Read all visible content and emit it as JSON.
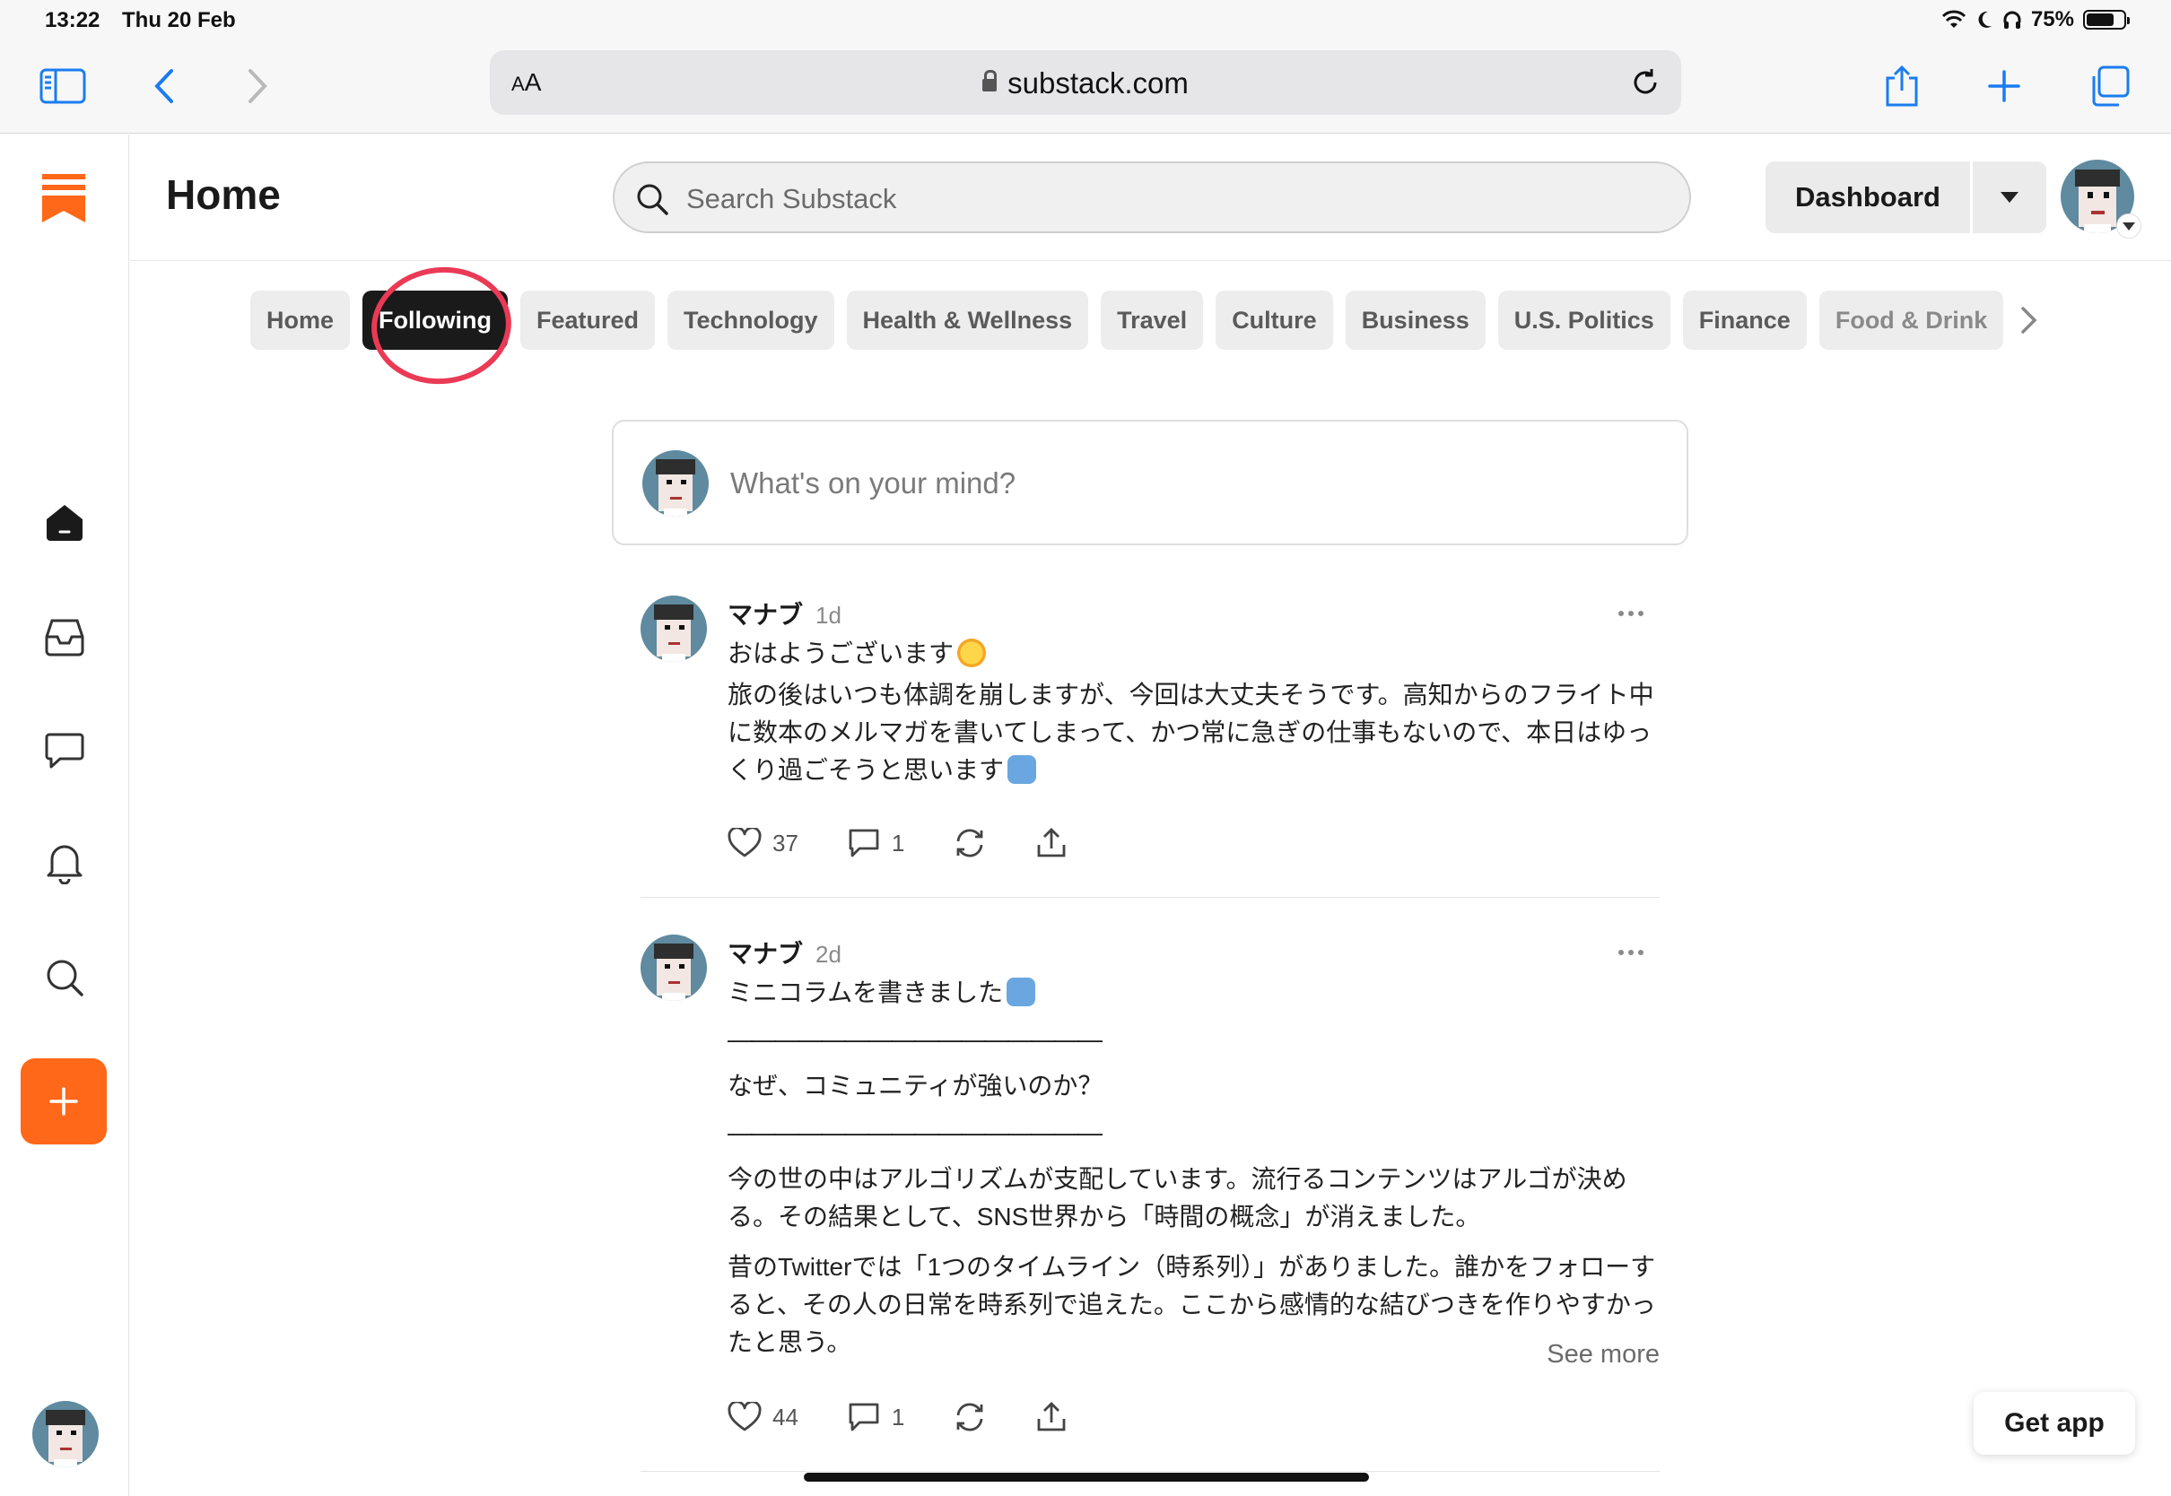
{
  "status_bar": {
    "time": "13:22",
    "date": "Thu 20 Feb",
    "battery": "75%",
    "battery_level": 0.75
  },
  "browser": {
    "text_size_label_small": "A",
    "text_size_label_large": "A",
    "url": "substack.com"
  },
  "header": {
    "title": "Home",
    "search_placeholder": "Search Substack",
    "dashboard_label": "Dashboard"
  },
  "tabs": [
    {
      "label": "Home",
      "active": false
    },
    {
      "label": "Following",
      "active": true
    },
    {
      "label": "Featured",
      "active": false
    },
    {
      "label": "Technology",
      "active": false
    },
    {
      "label": "Health & Wellness",
      "active": false
    },
    {
      "label": "Travel",
      "active": false
    },
    {
      "label": "Culture",
      "active": false
    },
    {
      "label": "Business",
      "active": false
    },
    {
      "label": "U.S. Politics",
      "active": false
    },
    {
      "label": "Finance",
      "active": false
    },
    {
      "label": "Food & Drink",
      "active": false
    }
  ],
  "composer": {
    "placeholder": "What's on your mind?"
  },
  "posts": [
    {
      "author": "マナブ",
      "ago": "1d",
      "paragraphs": [
        "おはようございます",
        "旅の後はいつも体調を崩しますが、今回は大丈夫そうです。高知からのフライト中に数本のメルマガを書いてしまって、かつ常に急ぎの仕事もないので、本日はゆっくり過ごそうと思います"
      ],
      "likes": "37",
      "comments": "1"
    },
    {
      "author": "マナブ",
      "ago": "2d",
      "paragraphs": [
        "ミニコラムを書きました",
        "————————————————",
        "なぜ、コミュニティが強いのか？",
        "————————————————",
        "今の世の中はアルゴリズムが支配しています。流行るコンテンツはアルゴが決める。その結果として、SNS世界から「時間の概念」が消えました。",
        "昔のTwitterでは「1つのタイムライン（時系列）」がありました。誰かをフォローすると、その人の日常を時系列で追えた。ここから感情的な結びつきを作りやすかったと思う。"
      ],
      "see_more": "See more",
      "likes": "44",
      "comments": "1"
    }
  ],
  "get_app": "Get app",
  "colors": {
    "brand": "#ff6719",
    "active_tab": "#1a1a1a",
    "annotation_circle": "#ea3a55"
  },
  "icons": [
    "sidebar-icon",
    "back-icon",
    "forward-icon",
    "lock-icon",
    "reload-icon",
    "share-icon",
    "plus-icon",
    "tabs-icon",
    "home-icon",
    "inbox-icon",
    "chat-icon",
    "bell-icon",
    "search-icon",
    "heart-icon",
    "comment-icon",
    "restack-icon",
    "share-icon",
    "more-icon"
  ]
}
